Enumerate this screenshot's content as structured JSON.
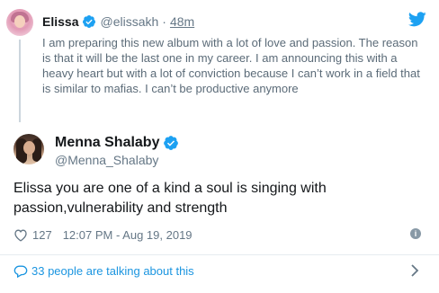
{
  "colors": {
    "link": "#1b95e0",
    "verified": "#1da1f2",
    "muted": "#657786",
    "twitter_blue": "#1da1f2"
  },
  "quoted_tweet": {
    "name": "Elissa",
    "handle": "@elissakh",
    "separator": "·",
    "time": "48m",
    "text": "I am preparing this new album with a lot of love and passion. The reason is that it will be the last one in my career. I am announcing this with a heavy heart but with a lot of conviction because I can’t work in a field that is similar to mafias. I can’t be productive anymore",
    "icons": {
      "verified": "verified-badge-icon",
      "brand": "twitter-bird-icon"
    }
  },
  "tweet": {
    "name": "Menna Shalaby",
    "handle": "@Menna_Shalaby",
    "text": "Elissa you are one of a kind a soul is singing with passion,vulnerability and strength",
    "likes": "127",
    "timestamp": "12:07 PM - Aug 19, 2019",
    "icons": {
      "like": "heart-icon",
      "info": "info-icon"
    }
  },
  "footer": {
    "talking_label": "33 people are talking about this",
    "icons": {
      "reply": "speech-bubble-icon",
      "chevron": "chevron-right-icon"
    }
  }
}
